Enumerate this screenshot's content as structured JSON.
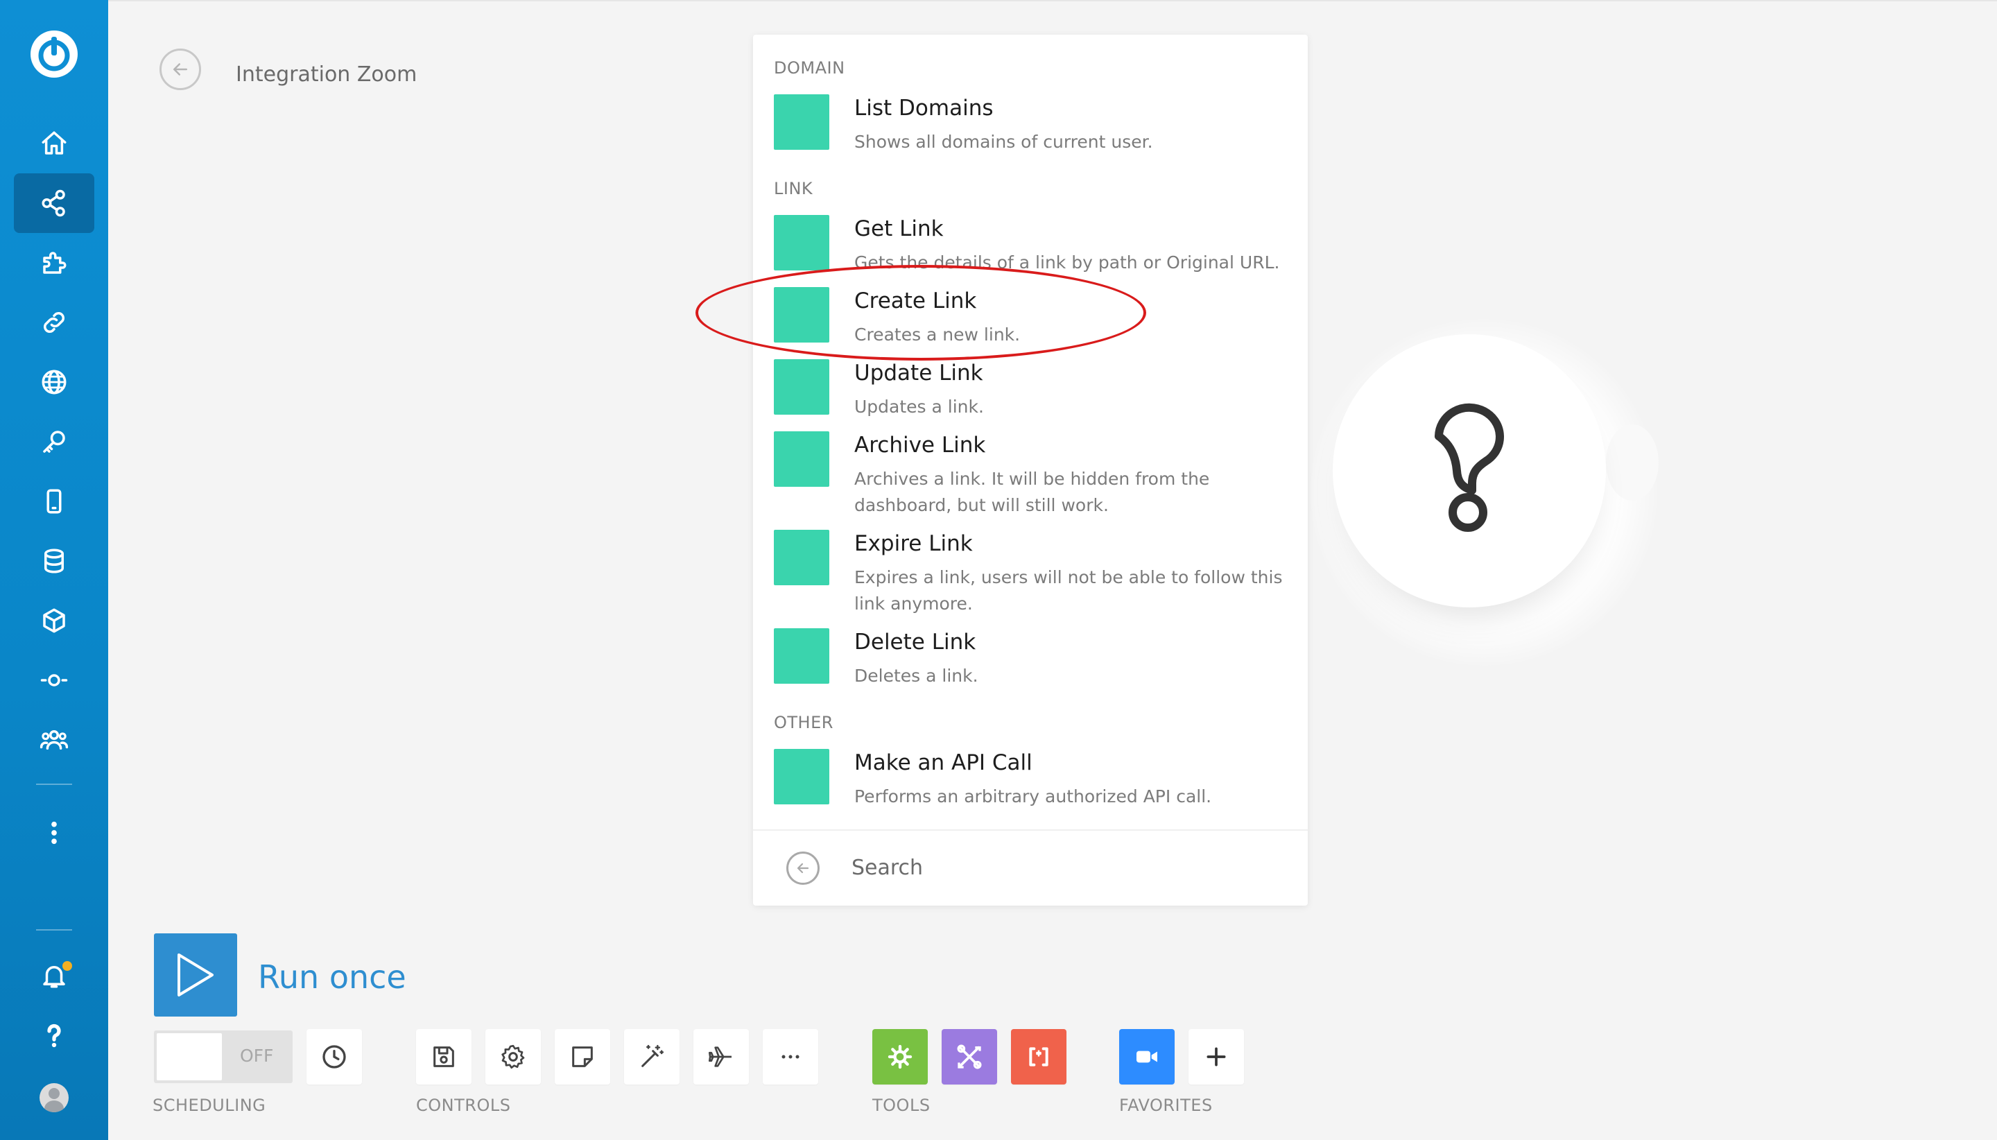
{
  "colors": {
    "sidebar": "#0e8fd4",
    "sidebar_active": "#096aa3",
    "module_color": "#3ad4ad",
    "accent_blue": "#2e8ed0",
    "highlight_red": "#d91b1b",
    "tool_green": "#79c142",
    "tool_purple": "#9b7be0",
    "tool_red": "#f0624b",
    "zoom_blue": "#2d8cff"
  },
  "sidebar": {
    "items": [
      {
        "icon": "home-icon"
      },
      {
        "icon": "share-icon",
        "active": true
      },
      {
        "icon": "puzzle-icon"
      },
      {
        "icon": "link-icon"
      },
      {
        "icon": "globe-icon"
      },
      {
        "icon": "key-icon"
      },
      {
        "icon": "mobile-icon"
      },
      {
        "icon": "database-icon"
      },
      {
        "icon": "box-icon"
      },
      {
        "icon": "flow-icon"
      },
      {
        "icon": "team-icon"
      },
      {
        "icon": "more-vertical-icon"
      }
    ],
    "bottom": [
      {
        "icon": "bell-icon",
        "has_notification": true
      },
      {
        "icon": "help-icon"
      },
      {
        "icon": "avatar"
      }
    ]
  },
  "header": {
    "scenario_title": "Integration Zoom"
  },
  "panel": {
    "sections": [
      {
        "label": "DOMAIN",
        "modules": [
          {
            "title": "List Domains",
            "description": "Shows all domains of current user."
          }
        ]
      },
      {
        "label": "LINK",
        "modules": [
          {
            "title": "Get Link",
            "description": "Gets the details of a link by path or Original URL."
          },
          {
            "title": "Create Link",
            "description": "Creates a new link.",
            "highlighted": true
          },
          {
            "title": "Update Link",
            "description": "Updates a link."
          },
          {
            "title": "Archive Link",
            "description": "Archives a link. It will be hidden from the dashboard, but will still work."
          },
          {
            "title": "Expire Link",
            "description": "Expires a link, users will not be able to follow this link anymore."
          },
          {
            "title": "Delete Link",
            "description": "Deletes a link."
          }
        ]
      },
      {
        "label": "OTHER",
        "modules": [
          {
            "title": "Make an API Call",
            "description": "Performs an arbitrary authorized API call."
          }
        ]
      }
    ],
    "search_placeholder": "Search"
  },
  "canvas": {
    "placeholder_icon": "question-mark-icon"
  },
  "run": {
    "label": "Run once"
  },
  "toolbar": {
    "toggle_label": "OFF",
    "scheduling_label": "SCHEDULING",
    "controls_label": "CONTROLS",
    "tools_label": "TOOLS",
    "favorites_label": "FAVORITES",
    "controls_icons": [
      "save-icon",
      "gear-icon",
      "note-icon",
      "magic-wand-icon",
      "airplane-icon",
      "ellipsis-icon"
    ],
    "tools_icons": [
      "tools-gear-icon",
      "tools-wrench-icon",
      "tools-brackets-icon"
    ],
    "favorites_icons": [
      "zoom-video-icon",
      "plus-icon"
    ]
  }
}
